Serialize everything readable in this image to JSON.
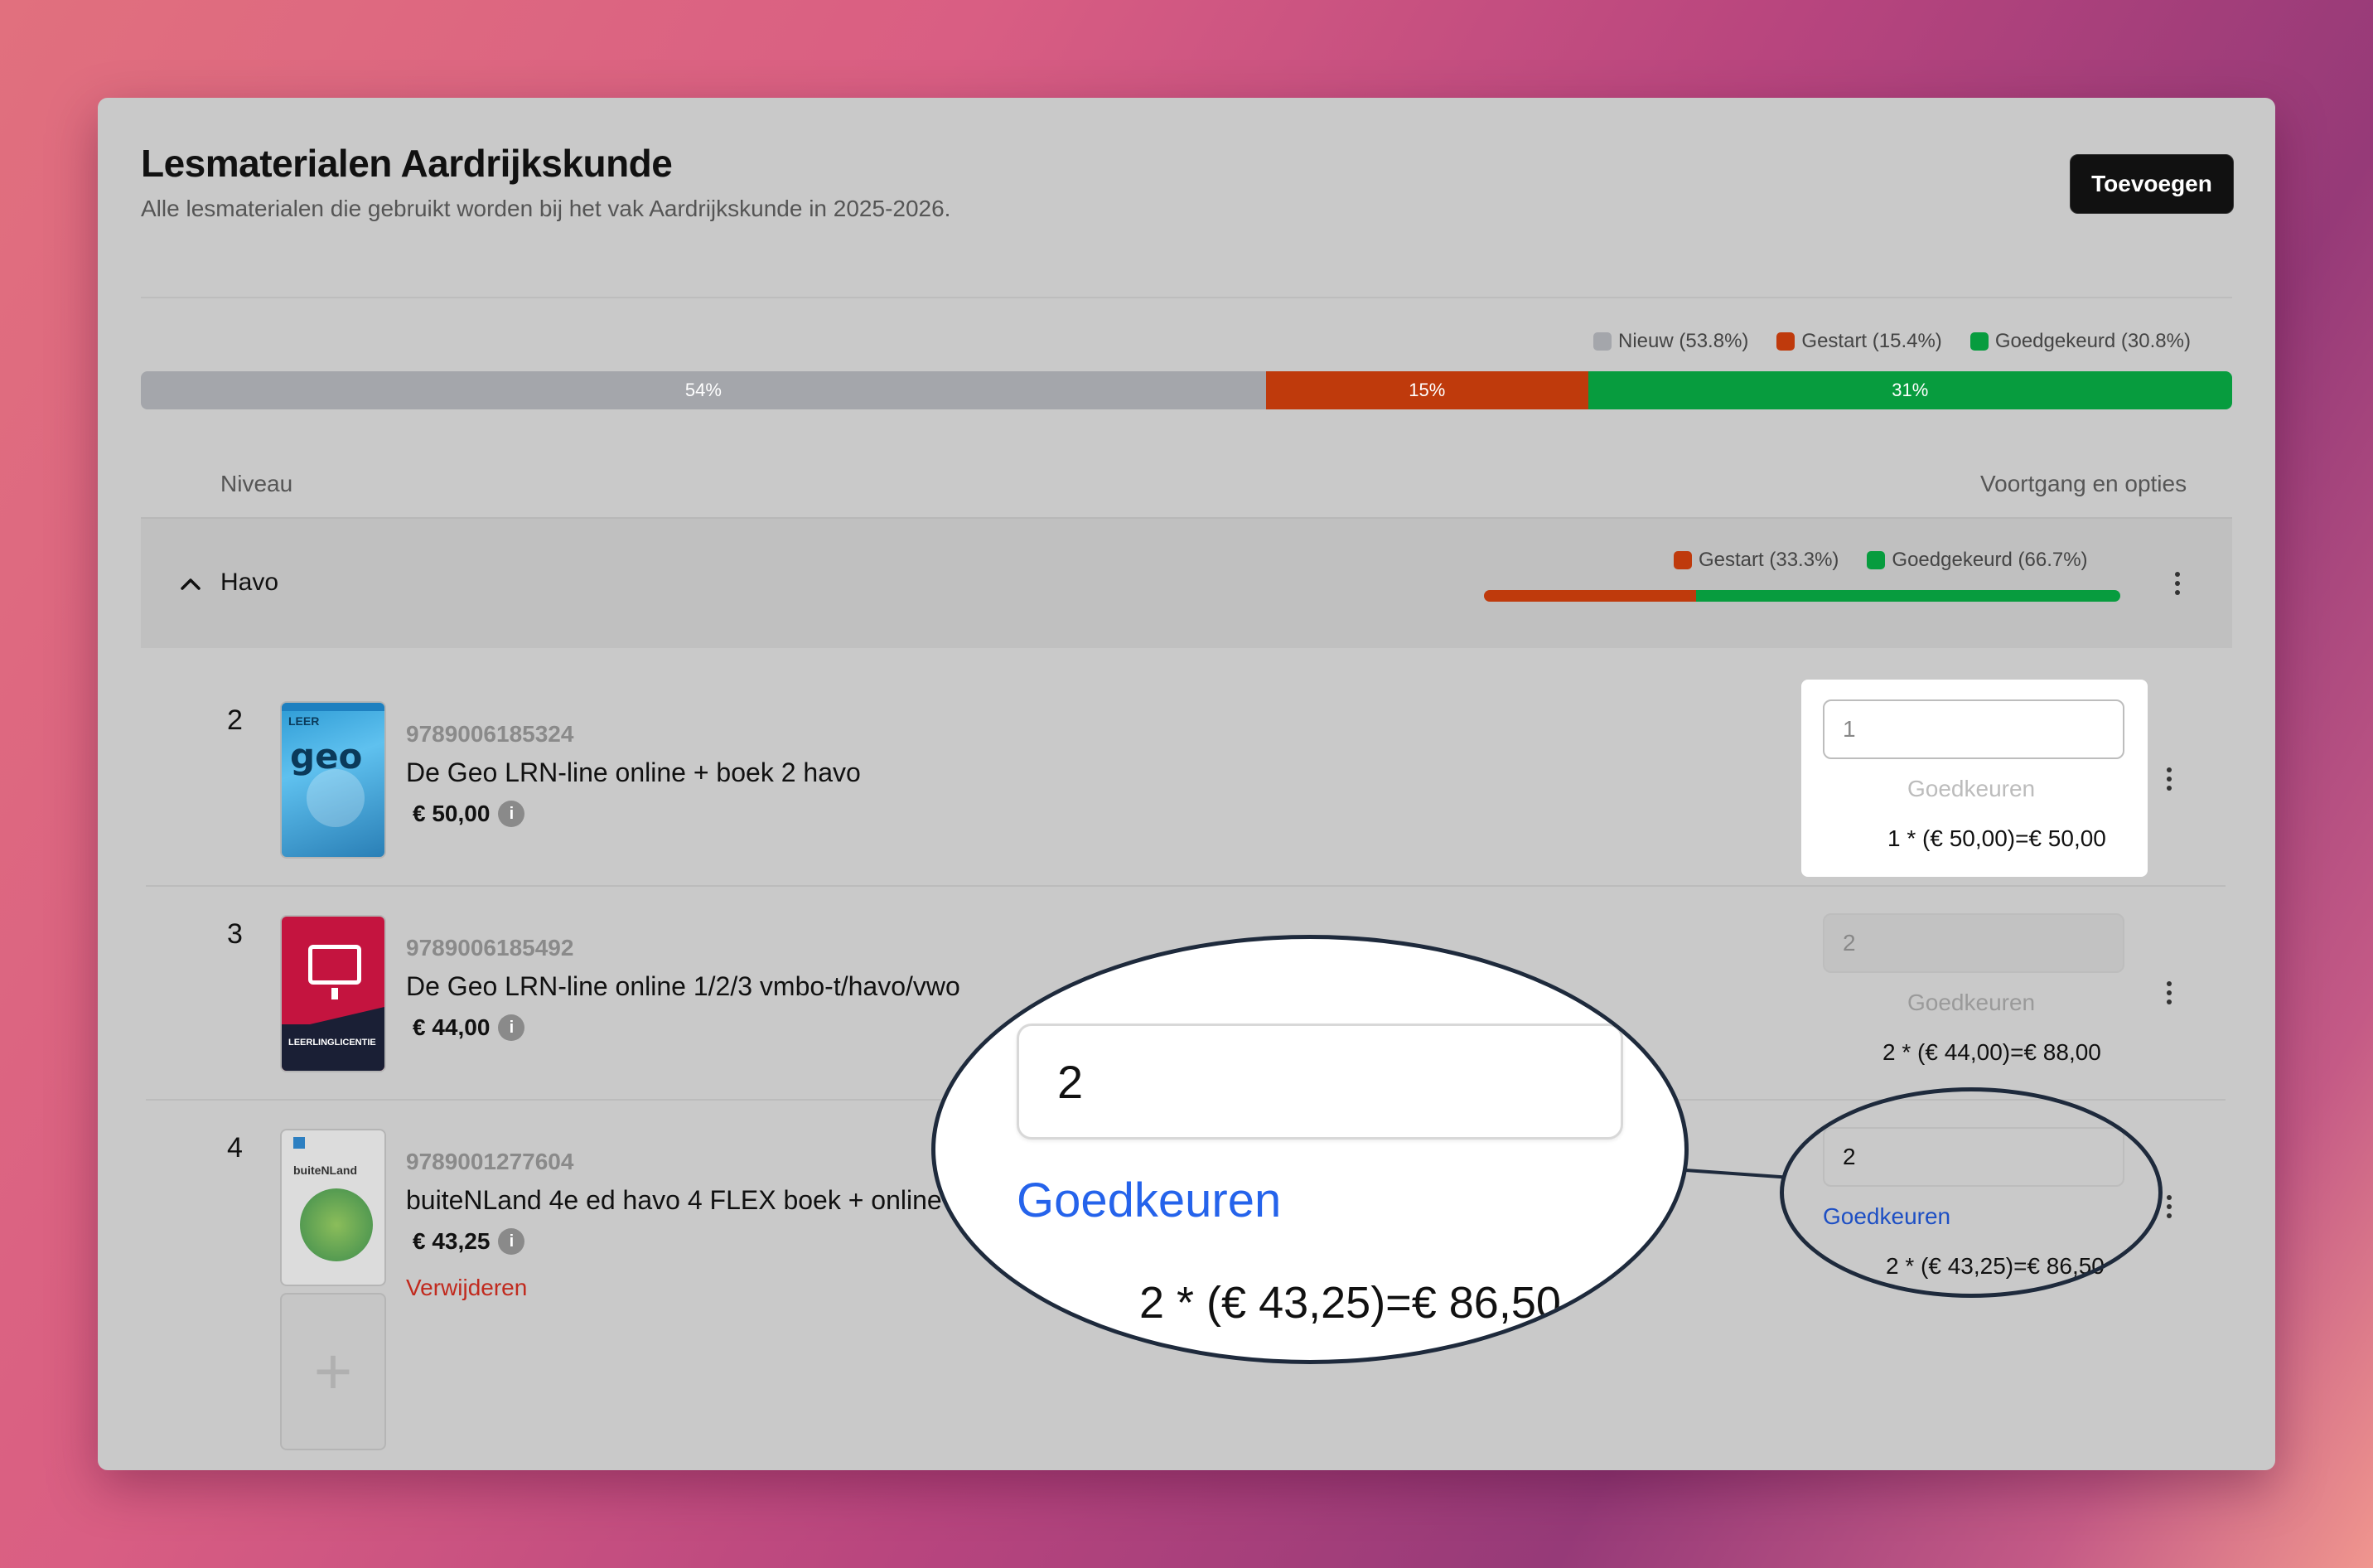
{
  "header": {
    "title": "Lesmaterialen Aardrijkskunde",
    "subtitle": "Alle lesmaterialen die gebruikt worden bij het vak Aardrijkskunde in 2025-2026.",
    "add_button": "Toevoegen"
  },
  "overall_progress": {
    "legend": [
      {
        "label": "Nieuw (53.8%)",
        "color": "#a4a6ab"
      },
      {
        "label": "Gestart (15.4%)",
        "color": "#bf3a0c"
      },
      {
        "label": "Goedgekeurd (30.8%)",
        "color": "#079c3e"
      }
    ],
    "segments": [
      {
        "label": "54%",
        "percent": 53.8,
        "color": "#a4a6ab"
      },
      {
        "label": "15%",
        "percent": 15.4,
        "color": "#bf3a0c"
      },
      {
        "label": "31%",
        "percent": 30.8,
        "color": "#079c3e"
      }
    ]
  },
  "table": {
    "col_level": "Niveau",
    "col_progress": "Voortgang en opties"
  },
  "group": {
    "name": "Havo",
    "legend": [
      {
        "label": "Gestart (33.3%)",
        "color": "#bf3a0c"
      },
      {
        "label": "Goedgekeurd (66.7%)",
        "color": "#079c3e"
      }
    ],
    "segments": [
      {
        "percent": 33.3,
        "color": "#bf3a0c"
      },
      {
        "percent": 66.7,
        "color": "#079c3e"
      }
    ]
  },
  "rows": [
    {
      "number": "2",
      "isbn": "9789006185324",
      "name": "De Geo LRN-line online + boek 2 havo",
      "price": "€ 50,00",
      "quantity": "1",
      "approve": "Goedkeuren",
      "calc": "1 * (€ 50,00)=€ 50,00",
      "thumb_text": "geo"
    },
    {
      "number": "3",
      "isbn": "9789006185492",
      "name": "De Geo LRN-line online 1/2/3 vmbo-t/havo/vwo",
      "price": "€ 44,00",
      "quantity": "2",
      "approve": "Goedkeuren",
      "calc": "2 * (€ 44,00)=€ 88,00",
      "thumb_text": "LEERLINGLICENTIE"
    },
    {
      "number": "4",
      "isbn": "9789001277604",
      "name": "buiteNLand 4e ed havo 4 FLEX boek + online",
      "price": "€ 43,25",
      "quantity": "2",
      "approve": "Goedkeuren",
      "calc": "2 * (€ 43,25)=€ 86,50",
      "remove": "Verwijderen",
      "thumb_text": "buiteNLand"
    }
  ],
  "callout": {
    "quantity": "2",
    "approve": "Goedkeuren",
    "calc": "2 * (€ 43,25)=€ 86,50"
  },
  "icons": {
    "info": "i",
    "plus": "+",
    "chevron": "^"
  }
}
